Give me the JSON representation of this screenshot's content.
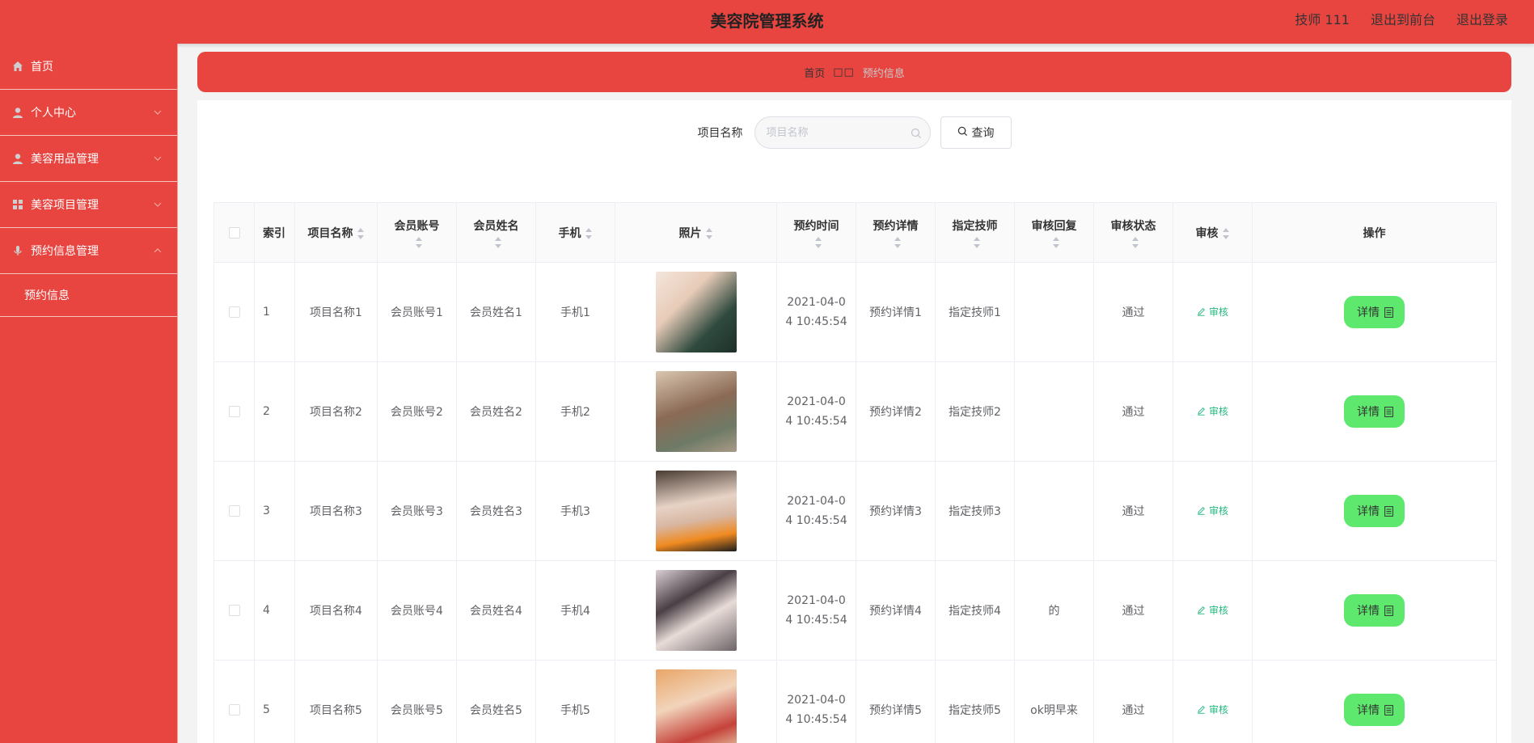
{
  "header": {
    "title": "美容院管理系统",
    "user": "技师 111",
    "to_front": "退出到前台",
    "logout": "退出登录"
  },
  "sidebar": {
    "items": [
      {
        "label": "首页",
        "icon": "home-icon"
      },
      {
        "label": "个人中心",
        "icon": "user-icon"
      },
      {
        "label": "美容用品管理",
        "icon": "user-icon"
      },
      {
        "label": "美容项目管理",
        "icon": "grid-icon"
      },
      {
        "label": "预约信息管理",
        "icon": "mic-icon"
      }
    ],
    "submenu": {
      "label": "预约信息"
    }
  },
  "breadcrumb": {
    "home": "首页",
    "sep": "□□",
    "current": "预约信息"
  },
  "search": {
    "label": "项目名称",
    "placeholder": "项目名称",
    "button": "查询"
  },
  "table": {
    "headers": {
      "index": "索引",
      "project": "项目名称",
      "account": "会员账号",
      "name": "会员姓名",
      "phone": "手机",
      "photo": "照片",
      "time": "预约时间",
      "detail": "预约详情",
      "tech": "指定技师",
      "reply": "审核回复",
      "status": "审核状态",
      "audit": "审核",
      "ops": "操作"
    },
    "audit_label": "审核",
    "detail_label": "详情",
    "rows": [
      {
        "index": "1",
        "project": "项目名称1",
        "account": "会员账号1",
        "name": "会员姓名1",
        "phone": "手机1",
        "time": "2021-04-04 10:45:54",
        "detail": "预约详情1",
        "tech": "指定技师1",
        "reply": "",
        "status": "通过"
      },
      {
        "index": "2",
        "project": "项目名称2",
        "account": "会员账号2",
        "name": "会员姓名2",
        "phone": "手机2",
        "time": "2021-04-04 10:45:54",
        "detail": "预约详情2",
        "tech": "指定技师2",
        "reply": "",
        "status": "通过"
      },
      {
        "index": "3",
        "project": "项目名称3",
        "account": "会员账号3",
        "name": "会员姓名3",
        "phone": "手机3",
        "time": "2021-04-04 10:45:54",
        "detail": "预约详情3",
        "tech": "指定技师3",
        "reply": "",
        "status": "通过"
      },
      {
        "index": "4",
        "project": "项目名称4",
        "account": "会员账号4",
        "name": "会员姓名4",
        "phone": "手机4",
        "time": "2021-04-04 10:45:54",
        "detail": "预约详情4",
        "tech": "指定技师4",
        "reply": "的",
        "status": "通过"
      },
      {
        "index": "5",
        "project": "项目名称5",
        "account": "会员账号5",
        "name": "会员姓名5",
        "phone": "手机5",
        "time": "2021-04-04 10:45:54",
        "detail": "预约详情5",
        "tech": "指定技师5",
        "reply": "ok明早来",
        "status": "通过"
      }
    ]
  },
  "colors": {
    "primary": "#e84540",
    "success_button": "#5ee86d",
    "audit_link": "#23b97f"
  }
}
